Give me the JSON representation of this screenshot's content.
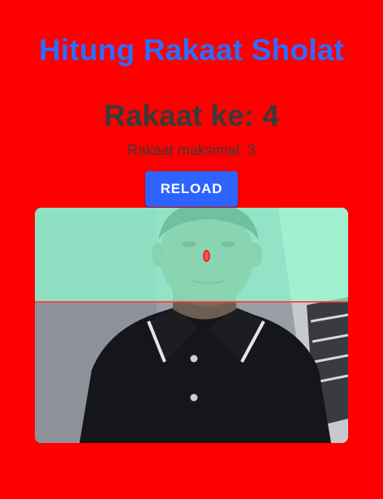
{
  "header": {
    "title": "Hitung Rakaat Sholat"
  },
  "counter": {
    "current": "Rakaat ke: 4",
    "maximum": "Rakaat maksimal: 3"
  },
  "actions": {
    "reload_label": "RELOAD"
  },
  "colors": {
    "background": "#ff0000",
    "title": "#2f6bff",
    "button": "#2e63ff",
    "detection_zone": "#90ffd2",
    "marker": "#ff3b3b"
  },
  "camera": {
    "description_icon": "webcam-feed"
  }
}
